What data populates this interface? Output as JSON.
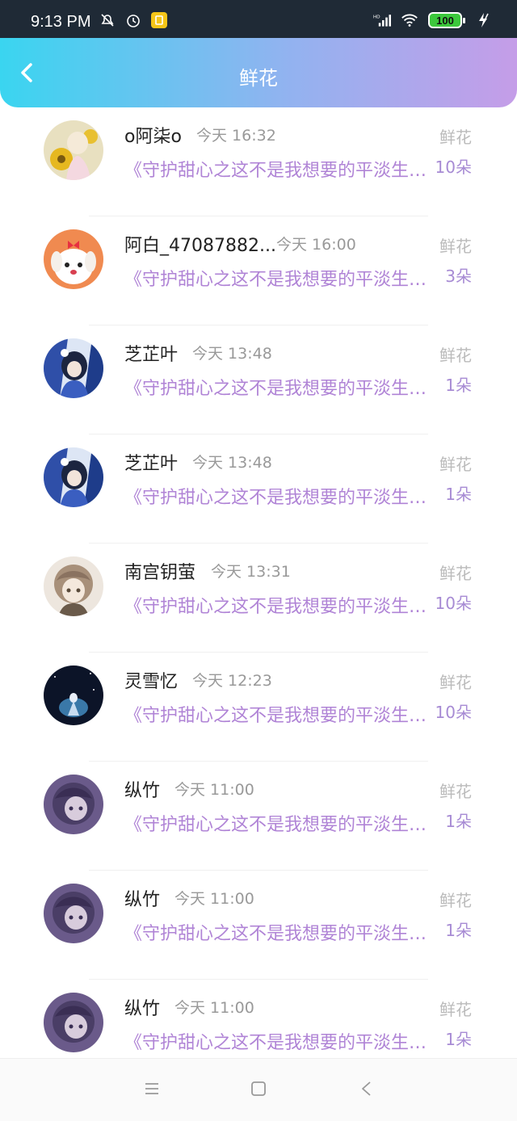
{
  "status_bar": {
    "time": "9:13 PM",
    "battery": "100",
    "icons": [
      "bell-off-icon",
      "alarm-icon",
      "app-badge-icon",
      "hd-signal-icon",
      "wifi-icon",
      "battery-icon",
      "charging-icon"
    ]
  },
  "header": {
    "title": "鲜花",
    "back_icon": "chevron-left-icon",
    "gradient": [
      "#3ad5f0",
      "#91b3f0",
      "#c59de8"
    ]
  },
  "items": [
    {
      "name": "o阿柒o",
      "time": "今天 16:32",
      "book": "《守护甜心之这不是我想要的平淡生活》",
      "gift": "鲜花",
      "count": "10朵"
    },
    {
      "name": "阿白_47087882...",
      "time": "今天 16:00",
      "book": "《守护甜心之这不是我想要的平淡生活》",
      "gift": "鲜花",
      "count": "3朵"
    },
    {
      "name": "芝芷叶",
      "time": "今天 13:48",
      "book": "《守护甜心之这不是我想要的平淡生活》",
      "gift": "鲜花",
      "count": "1朵"
    },
    {
      "name": "芝芷叶",
      "time": "今天 13:48",
      "book": "《守护甜心之这不是我想要的平淡生活》",
      "gift": "鲜花",
      "count": "1朵"
    },
    {
      "name": "南宫钥萤",
      "time": "今天 13:31",
      "book": "《守护甜心之这不是我想要的平淡生活》",
      "gift": "鲜花",
      "count": "10朵"
    },
    {
      "name": "灵雪忆",
      "time": "今天 12:23",
      "book": "《守护甜心之这不是我想要的平淡生活》",
      "gift": "鲜花",
      "count": "10朵"
    },
    {
      "name": "纵竹",
      "time": "今天 11:00",
      "book": "《守护甜心之这不是我想要的平淡生活》",
      "gift": "鲜花",
      "count": "1朵"
    },
    {
      "name": "纵竹",
      "time": "今天 11:00",
      "book": "《守护甜心之这不是我想要的平淡生活》",
      "gift": "鲜花",
      "count": "1朵"
    },
    {
      "name": "纵竹",
      "time": "今天 11:00",
      "book": "《守护甜心之这不是我想要的平淡生活》",
      "gift": "鲜花",
      "count": "1朵"
    }
  ],
  "navbar": {
    "icons": [
      "menu-icon",
      "home-square-icon",
      "back-triangle-icon"
    ]
  }
}
